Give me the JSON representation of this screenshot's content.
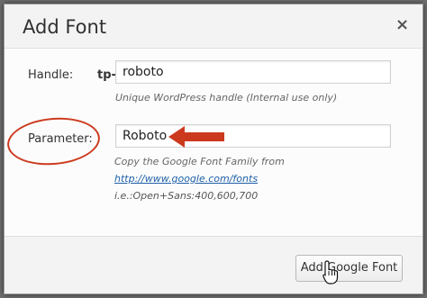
{
  "dialog": {
    "title": "Add Font",
    "close_glyph": "×"
  },
  "handle": {
    "label": "Handle:",
    "prefix": "tp-",
    "value": "roboto",
    "description": "Unique WordPress handle (Internal use only)"
  },
  "parameter": {
    "label": "Parameter:",
    "value": "Roboto",
    "description": "Copy the Google Font Family from",
    "link": "http://www.google.com/fonts",
    "example": "i.e.:Open+Sans:400,600,700"
  },
  "footer": {
    "button_label": "Add Google Font"
  },
  "annotations": {
    "highlight_color": "#cc3a1e"
  }
}
